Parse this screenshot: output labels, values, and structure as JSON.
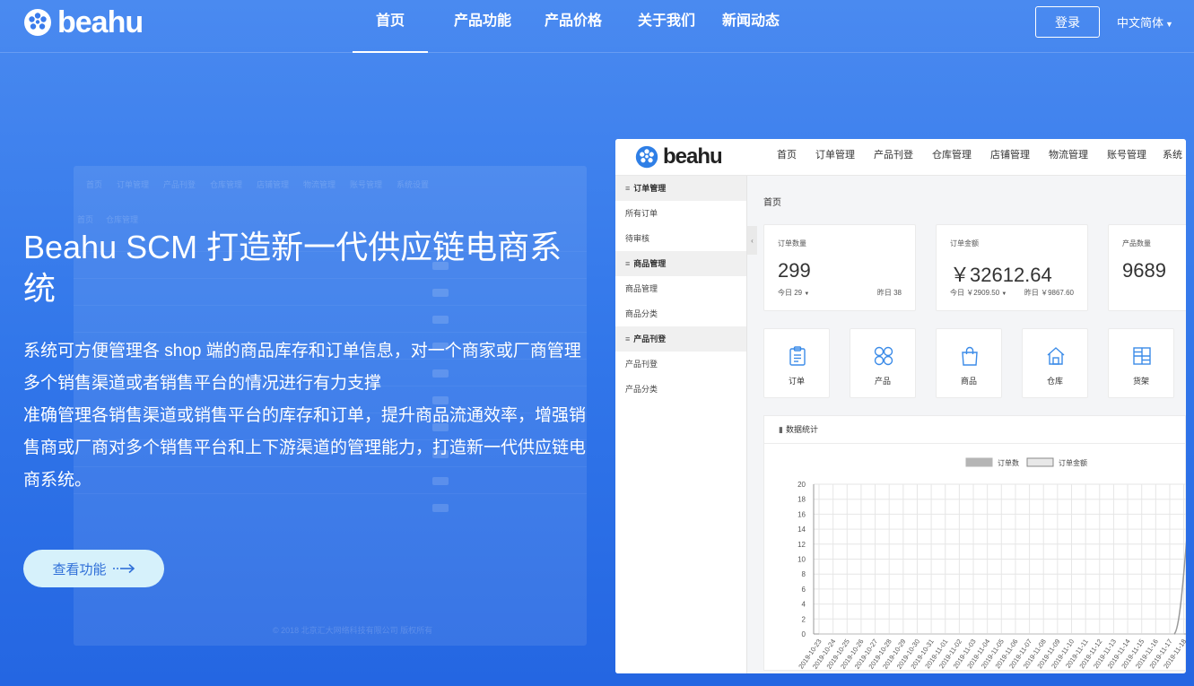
{
  "brand": {
    "name": "beahu"
  },
  "colors": {
    "primary_bg": "#3a7bec",
    "cta_bg": "#d6f1fb",
    "cta_text": "#2f6fd8",
    "accent_icon": "#3b8be8"
  },
  "nav": {
    "items": [
      {
        "label": "首页",
        "active": true
      },
      {
        "label": "产品功能",
        "active": false
      },
      {
        "label": "产品价格",
        "active": false
      },
      {
        "label": "关于我们",
        "active": false
      },
      {
        "label": "新闻动态",
        "active": false
      }
    ],
    "login": "登录",
    "language": "中文简体"
  },
  "hero": {
    "title": "Beahu SCM 打造新一代供应链电商系统",
    "desc1": "系统可方便管理各 shop 端的商品库存和订单信息，对一个商家或厂商管理多个销售渠道或者销售平台的情况进行有力支撑",
    "desc2": "准确管理各销售渠道或销售平台的库存和订单，提升商品流通效率，增强销售商或厂商对多个销售平台和上下游渠道的管理能力，打造新一代供应链电商系统。",
    "cta": "查看功能"
  },
  "ghost": {
    "nav": [
      "首页",
      "订单管理",
      "产品刊登",
      "仓库管理",
      "店铺管理",
      "物流管理",
      "账号管理",
      "系统设置"
    ],
    "crumb": [
      "首页",
      "仓库管理"
    ],
    "footer": "© 2018 北京汇大网络科技有限公司 版权所有"
  },
  "mock": {
    "nav": [
      "首页",
      "订单管理",
      "产品刊登",
      "仓库管理",
      "店铺管理",
      "物流管理",
      "账号管理",
      "系统"
    ],
    "sidebar": [
      {
        "group": "订单管理",
        "items": [
          "所有订单",
          "待审核"
        ]
      },
      {
        "group": "商品管理",
        "items": [
          "商品管理",
          "商品分类"
        ]
      },
      {
        "group": "产品刊登",
        "items": [
          "产品刊登",
          "产品分类"
        ]
      }
    ],
    "breadcrumb": "首页",
    "stats": [
      {
        "label": "订单数量",
        "value": "299",
        "sub_left": "今日 29",
        "sub_right": "昨日 38"
      },
      {
        "label": "订单金额",
        "value": "￥32612.64",
        "sub_left": "今日 ￥2909.50",
        "sub_right": "昨日 ￥9867.60"
      },
      {
        "label": "产品数量",
        "value": "9689",
        "sub_left": "",
        "sub_right": ""
      }
    ],
    "tiles": [
      {
        "label": "订单",
        "icon": "clipboard-icon"
      },
      {
        "label": "产品",
        "icon": "grid-icon"
      },
      {
        "label": "商品",
        "icon": "shopping-bag-icon"
      },
      {
        "label": "仓库",
        "icon": "warehouse-icon"
      },
      {
        "label": "货架",
        "icon": "shelf-icon"
      }
    ],
    "chart_title": "数据统计"
  },
  "chart_data": {
    "type": "area",
    "title": "",
    "xlabel": "",
    "ylabel": "",
    "ylim": [
      0,
      20
    ],
    "yticks": [
      0,
      2,
      4,
      6,
      8,
      10,
      12,
      14,
      16,
      18,
      20
    ],
    "grid": true,
    "legend_position": "top",
    "x": [
      "2019-10-23",
      "2019-10-24",
      "2019-10-25",
      "2019-10-26",
      "2019-10-27",
      "2019-10-28",
      "2019-10-29",
      "2019-10-30",
      "2019-10-31",
      "2019-11-01",
      "2019-11-02",
      "2019-11-03",
      "2019-11-04",
      "2019-11-05",
      "2019-11-06",
      "2019-11-07",
      "2019-11-08",
      "2019-11-09",
      "2019-11-10",
      "2019-11-11",
      "2019-11-12",
      "2019-11-13",
      "2019-11-14",
      "2019-11-15",
      "2019-11-16",
      "2019-11-17",
      "2019-11-18"
    ],
    "series": [
      {
        "name": "订单数",
        "values": [
          0,
          0,
          0,
          0,
          0,
          0,
          0,
          0,
          0,
          0,
          0,
          0,
          0,
          0,
          0,
          0,
          0,
          0,
          0,
          0,
          0,
          0,
          0,
          0,
          0,
          0,
          0
        ]
      },
      {
        "name": "订单金额",
        "values": [
          0,
          0,
          0,
          0,
          0,
          0,
          0,
          0,
          0,
          0,
          0,
          0,
          0,
          0,
          0,
          0,
          0,
          0,
          0,
          0,
          0,
          0,
          0,
          0,
          0,
          0,
          0
        ]
      }
    ]
  }
}
